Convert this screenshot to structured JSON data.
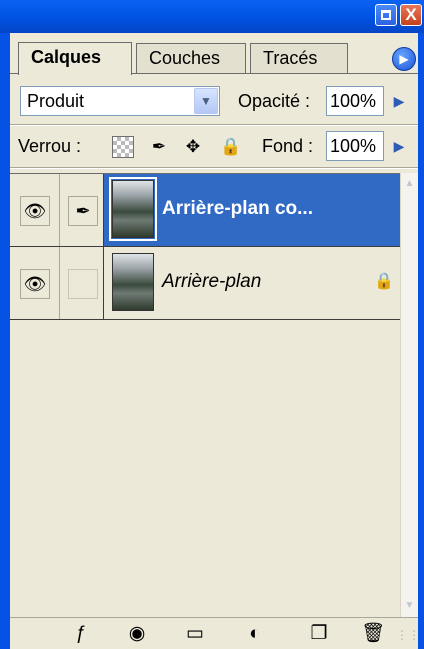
{
  "window": {
    "minimize_icon": "minimize-icon",
    "close_icon": "close-icon",
    "close_glyph": "X"
  },
  "tabs": [
    {
      "label": "Calques",
      "active": true
    },
    {
      "label": "Couches",
      "active": false
    },
    {
      "label": "Tracés",
      "active": false
    }
  ],
  "panel_menu_icon": "triangle-right-icon",
  "blend": {
    "mode": "Produit",
    "opacity_label": "Opacité :",
    "opacity_value": "100%"
  },
  "lock": {
    "label": "Verrou :",
    "icons": [
      "transparency-lock-icon",
      "brush-lock-icon",
      "move-lock-icon",
      "padlock-icon"
    ],
    "fill_label": "Fond :",
    "fill_value": "100%"
  },
  "layers": [
    {
      "name": "Arrière-plan co...",
      "visible": true,
      "paint_link": true,
      "selected": true,
      "locked": false
    },
    {
      "name": "Arrière-plan",
      "visible": true,
      "paint_link": false,
      "selected": false,
      "locked": true
    }
  ],
  "toolbar": {
    "icons": [
      "layer-style-icon",
      "layer-mask-icon",
      "new-group-icon",
      "adjustment-layer-icon",
      "new-layer-icon",
      "trash-icon"
    ]
  },
  "colors": {
    "chrome_blue": "#0552e4",
    "selection_blue": "#316ac5",
    "panel_bg": "#ece9d8"
  }
}
